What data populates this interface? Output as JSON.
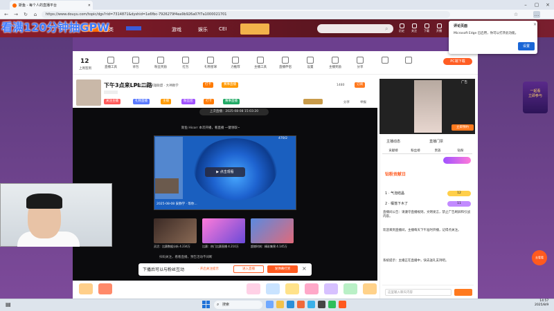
{
  "browser": {
    "tab_title": "斯鱼 - 每个人的直播平台",
    "url": "https://www.douyu.com/topic/dgs?rid=7314871&dyshid=1e6fbc-7926279f4ea9b926a07f7a1000021701"
  },
  "overlay_text": "看满120分钟抽GPW",
  "site": {
    "nav": [
      "分类",
      "",
      "游戏",
      "娱乐",
      "CEI"
    ],
    "header_icons": [
      "历史",
      "关注",
      "下载",
      "开播",
      "消息"
    ],
    "popup": {
      "title": "评论页面",
      "body": "Microsoft Edge 已启用，你可以打开此功能。",
      "button": "设置"
    }
  },
  "toolbar": {
    "level": "12",
    "items": [
      "上周签到",
      "直播工具",
      "背包",
      "粉丝奖励",
      "红包",
      "礼物星球",
      "力推荐",
      "主播工具",
      "直播伴侣",
      "设置",
      "主播奖励",
      "分享"
    ],
    "pc_button": "PC端下载"
  },
  "stream": {
    "title": "下午3点来LPL二路",
    "subtitle": "网游竞技 · 英雄联盟 · 大神教学",
    "tags": [
      "关注主播",
      "礼物直播",
      "主播",
      "粉丝团",
      "打卡",
      "赛事直播"
    ],
    "follow_count": "1480",
    "subscribe": "订阅",
    "share": "分享",
    "report": "举报"
  },
  "video": {
    "broadcast_time": "上次直播：2025-08-08 15:03:20",
    "notice": "斯鱼 Hicorr 本次开播，看直播 一键领取~",
    "desktop_caption": "2025-08-08 安静学 · 等你...",
    "play_label": "▶ 点击观看",
    "desktop_badge": "470/2",
    "tip": "扫码关注，看看直播，预告活动不间断",
    "thumbs": [
      {
        "caption": "灵活：比赛数据分析",
        "stat": "4.234万"
      },
      {
        "caption": "比赛：热门比赛直播",
        "stat": "4.210万"
      },
      {
        "caption": "超燃时刻：精彩集锦",
        "stat": "4.145万"
      }
    ],
    "promo": {
      "text": "下播后可以与粉丝互动",
      "note": "· 开启关注提示",
      "btn1": "进入直播",
      "btn2": "发弹幕打赏"
    }
  },
  "right": {
    "ad_label": "广告",
    "ad_button": "立即预约",
    "tabs": [
      "主播动态",
      "直播门票"
    ],
    "subtabs": [
      "贡献榜",
      "粉丝榜",
      "贵族",
      "钻粉"
    ],
    "rank_title": "钻粉贡献日",
    "rows": [
      {
        "name": "1 · 气泡结晶",
        "level": "12"
      },
      {
        "name": "2 · 橘落下木了",
        "level": "11"
      }
    ],
    "chat": [
      "直播间公告：请遵守直播规则，文明发言，禁止广告刷屏和引战内容。",
      "欢迎来到直播间，主播每天下午准时开播，记得点关注。",
      "系统提示：主播正在直播中，快去送礼支持吧。"
    ],
    "input_placeholder": "这里输入聊天内容"
  },
  "side_promo": {
    "title": "一起看",
    "button": "立即参与",
    "badge": "去看看"
  },
  "taskbar": {
    "search": "搜索",
    "time": "14:57",
    "date": "2025/8/9"
  }
}
